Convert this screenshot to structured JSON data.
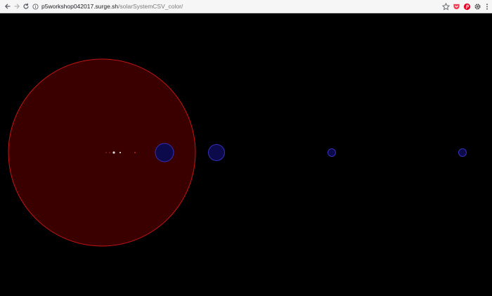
{
  "browser": {
    "url_host": "p5workshop042017.surge.sh",
    "url_path": "/solarSystemCSV_color/"
  },
  "icons": {
    "back": "arrow-left-icon",
    "forward": "arrow-right-icon",
    "reload": "reload-icon",
    "site_info": "info-icon",
    "bookmark": "star-icon",
    "pocket": "pocket-icon",
    "pinterest": "pinterest-icon",
    "extension": "gear-icon",
    "menu": "kebab-menu-icon"
  },
  "colors": {
    "canvas_background": "#000000",
    "sun_fill": "#3a0000",
    "sun_stroke": "#c41414",
    "planet_fill": "#0c0a4a",
    "planet_stroke": "#3430b8",
    "pocket": "#ef3f56",
    "pinterest": "#e60023"
  }
}
